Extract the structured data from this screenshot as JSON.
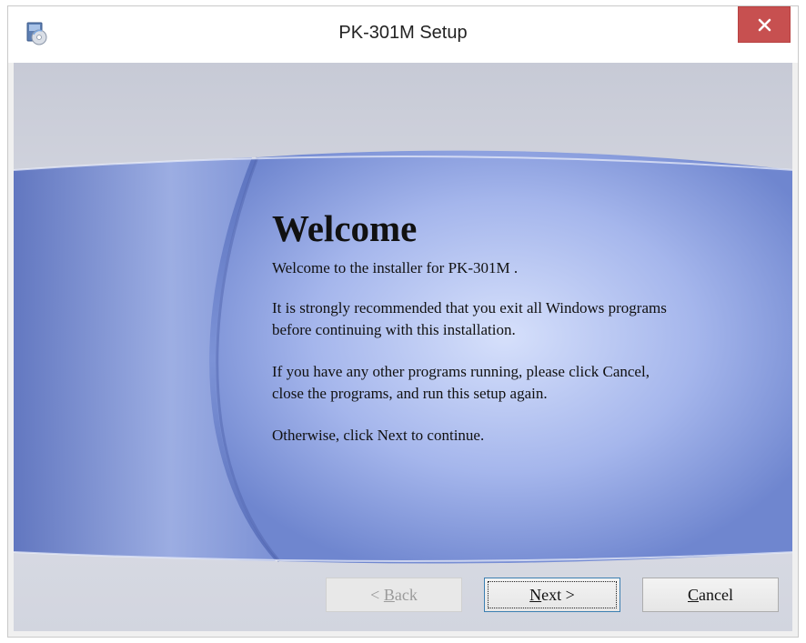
{
  "window": {
    "title": "PK-301M Setup"
  },
  "welcome": {
    "heading": "Welcome",
    "intro": "Welcome to the installer for PK-301M .",
    "paragraph1_line1": "It is strongly recommended that you exit all Windows programs",
    "paragraph1_line2": "before continuing with this installation.",
    "paragraph2_line1": "If you have any other programs running, please click Cancel,",
    "paragraph2_line2": "close the programs, and run this setup again.",
    "paragraph3": "Otherwise, click Next to continue."
  },
  "buttons": {
    "back_prefix": "< ",
    "back_mnemonic": "B",
    "back_rest": "ack",
    "next_mnemonic": "N",
    "next_rest": "ext >",
    "cancel_mnemonic": "C",
    "cancel_rest": "ancel"
  },
  "icons": {
    "app": "setup-installer-icon",
    "close": "close-icon"
  },
  "colors": {
    "close_button": "#c75050",
    "banner_blue": "#6f86cf",
    "banner_highlight": "#c4d0f2"
  }
}
